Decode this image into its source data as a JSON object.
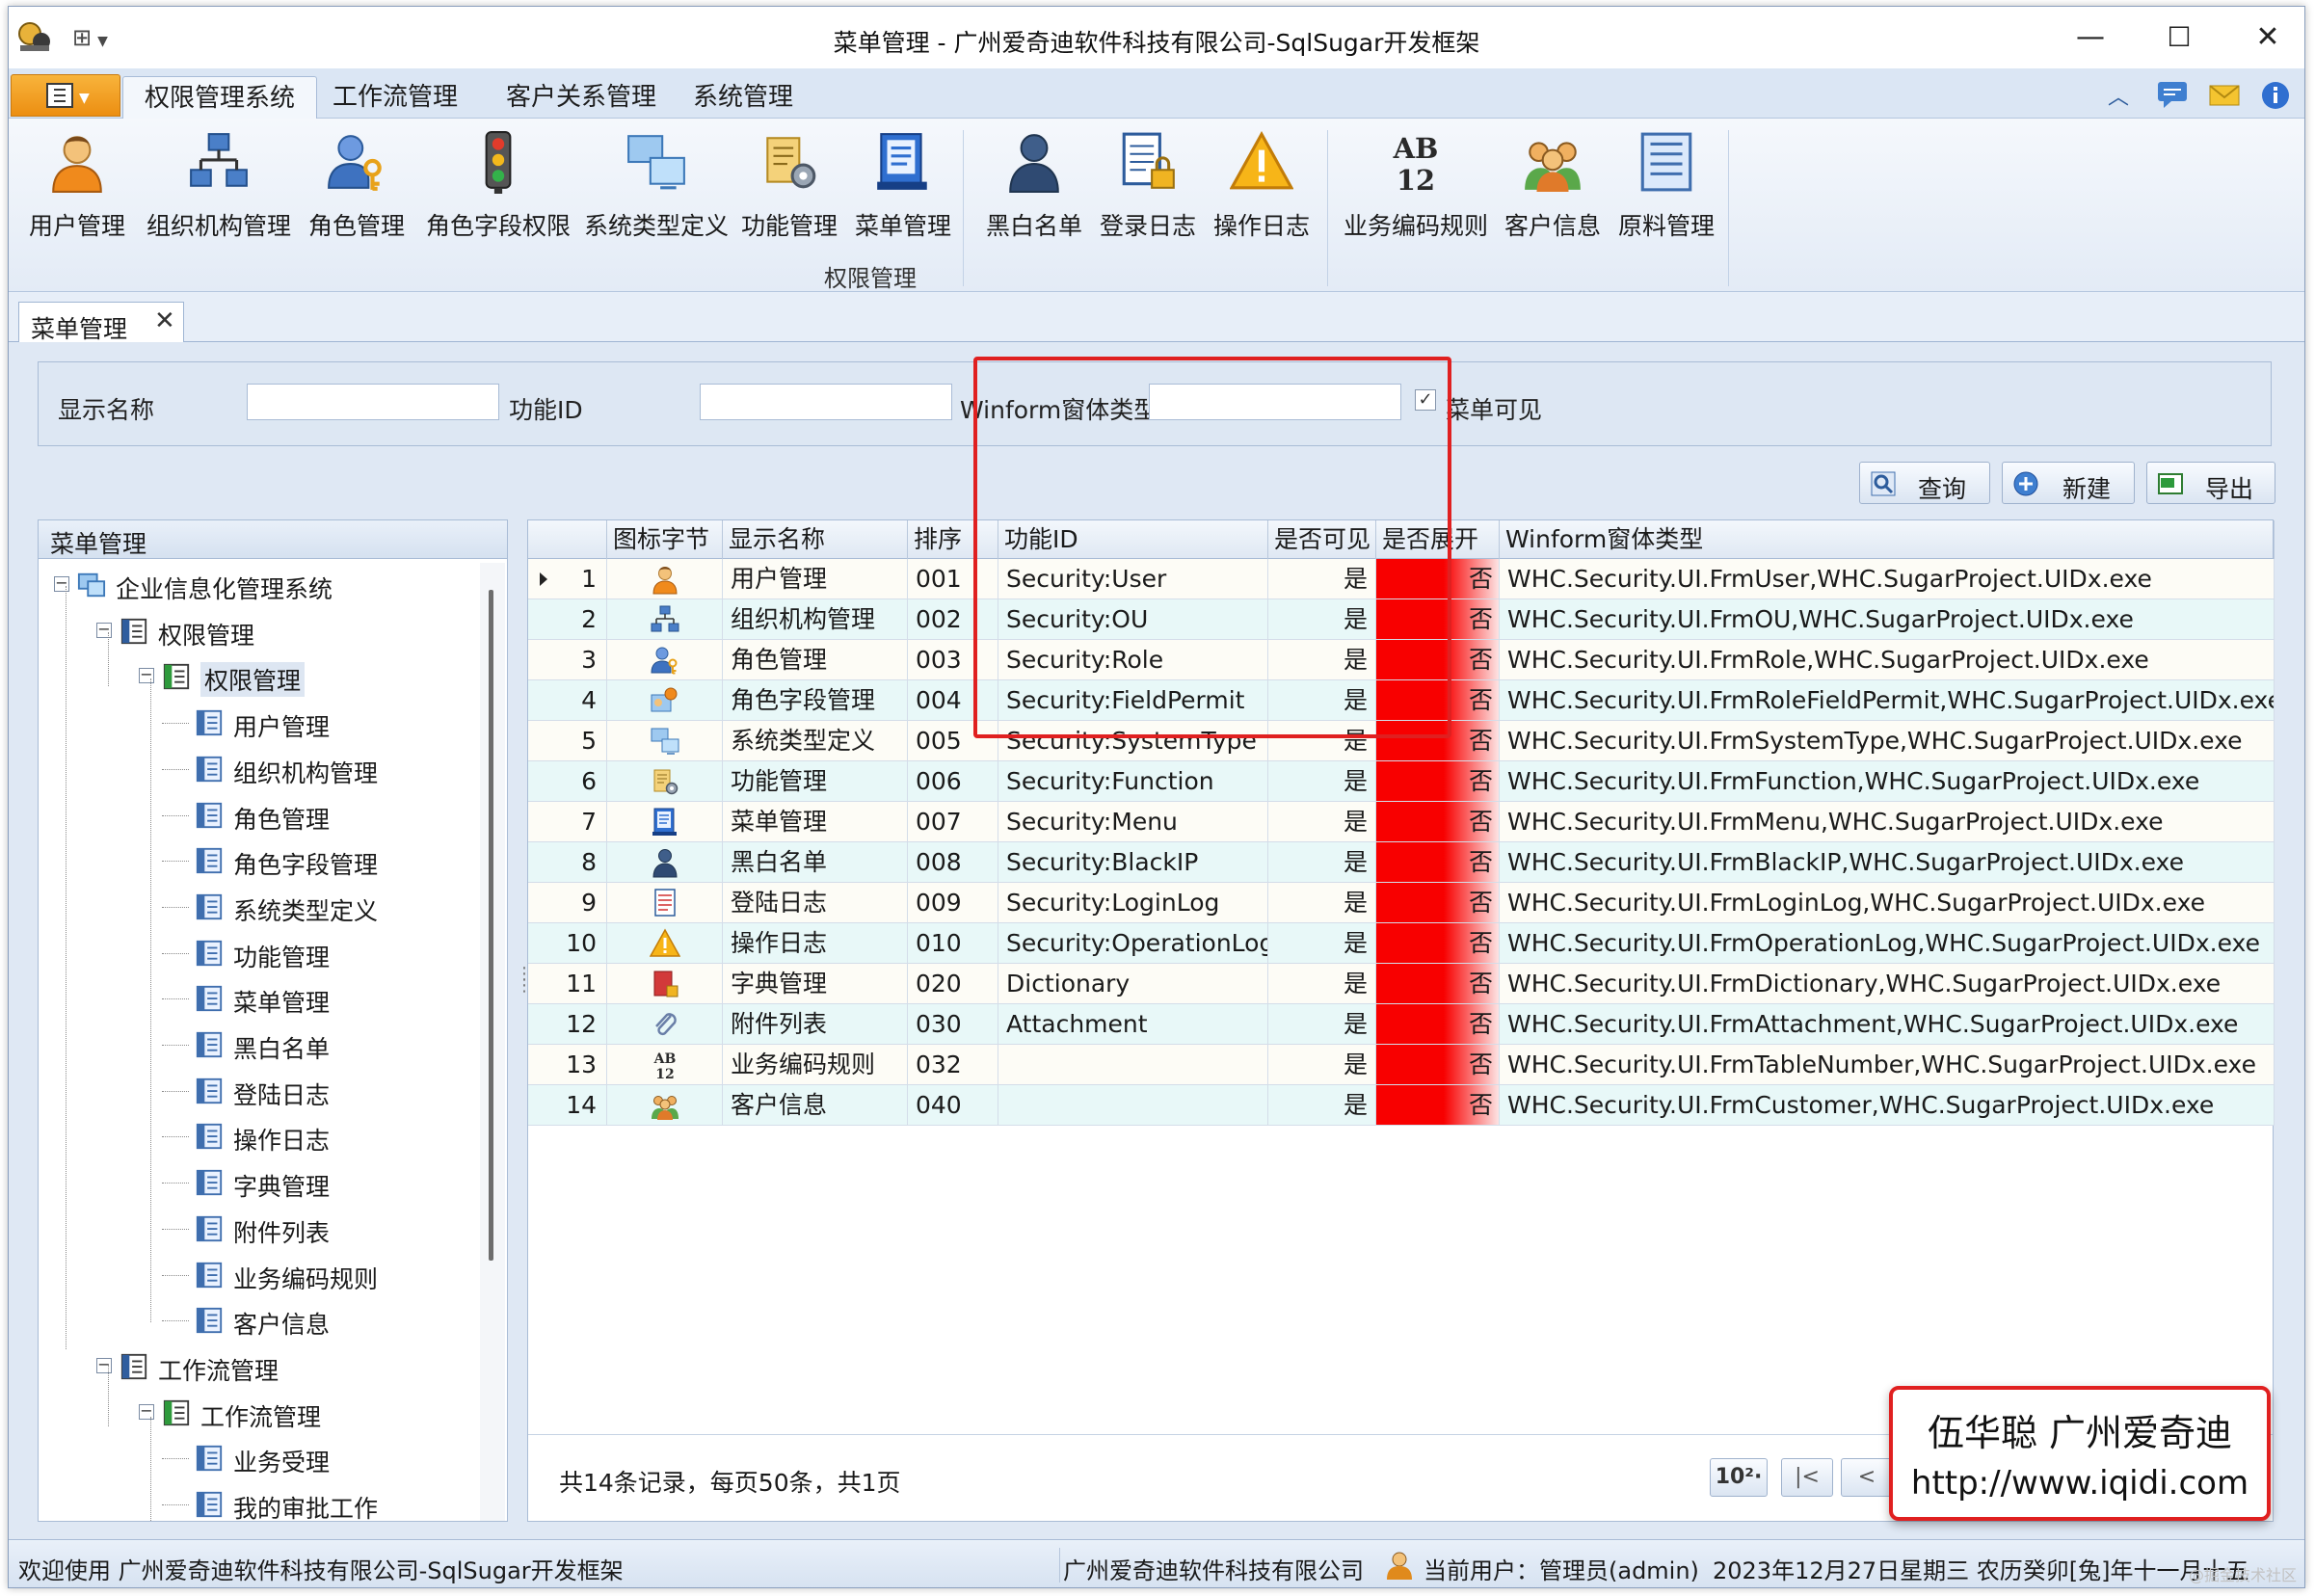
{
  "window": {
    "title": "菜单管理 - 广州爱奇迪软件科技有限公司-SqlSugar开发框架",
    "minimize": "—",
    "maximize": "☐",
    "close": "✕"
  },
  "ribbon": {
    "tabs": [
      "权限管理系统",
      "工作流管理",
      "客户关系管理",
      "系统管理"
    ],
    "buttons": [
      {
        "label": "用户管理",
        "icon": "user-icon"
      },
      {
        "label": "组织机构管理",
        "icon": "org-chart-icon"
      },
      {
        "label": "角色管理",
        "icon": "role-key-icon"
      },
      {
        "label": "角色字段权限",
        "icon": "traffic-light-icon"
      },
      {
        "label": "系统类型定义",
        "icon": "monitors-icon"
      },
      {
        "label": "功能管理",
        "icon": "function-gear-icon"
      },
      {
        "label": "菜单管理",
        "icon": "menu-book-icon"
      },
      {
        "label": "黑白名单",
        "icon": "person-icon"
      },
      {
        "label": "登录日志",
        "icon": "log-lock-icon"
      },
      {
        "label": "操作日志",
        "icon": "warning-icon"
      },
      {
        "label": "业务编码规则",
        "icon": "ab12-icon"
      },
      {
        "label": "客户信息",
        "icon": "customers-icon"
      },
      {
        "label": "原料管理",
        "icon": "material-list-icon"
      }
    ],
    "group_label": "权限管理"
  },
  "doc_tab": {
    "label": "菜单管理",
    "close": "✕"
  },
  "search": {
    "display_name_label": "显示名称",
    "function_id_label": "功能ID",
    "winform_label": "Winform窗体类型",
    "visible_label": "菜单可见",
    "visible_checked": "✓",
    "display_name_value": "",
    "function_id_value": "",
    "winform_value": ""
  },
  "actions": {
    "query": "查询",
    "new": "新建",
    "export": "导出"
  },
  "tree": {
    "header": "菜单管理",
    "nodes": [
      {
        "label": "企业信息化管理系统",
        "level": 0,
        "exp": "−"
      },
      {
        "label": "权限管理",
        "level": 1,
        "exp": "−"
      },
      {
        "label": "权限管理",
        "level": 2,
        "exp": "−"
      },
      {
        "label": "用户管理",
        "level": 3
      },
      {
        "label": "组织机构管理",
        "level": 3
      },
      {
        "label": "角色管理",
        "level": 3
      },
      {
        "label": "角色字段管理",
        "level": 3
      },
      {
        "label": "系统类型定义",
        "level": 3
      },
      {
        "label": "功能管理",
        "level": 3
      },
      {
        "label": "菜单管理",
        "level": 3
      },
      {
        "label": "黑白名单",
        "level": 3
      },
      {
        "label": "登陆日志",
        "level": 3
      },
      {
        "label": "操作日志",
        "level": 3
      },
      {
        "label": "字典管理",
        "level": 3
      },
      {
        "label": "附件列表",
        "level": 3
      },
      {
        "label": "业务编码规则",
        "level": 3
      },
      {
        "label": "客户信息",
        "level": 3
      },
      {
        "label": "工作流管理",
        "level": 1,
        "exp": "−"
      },
      {
        "label": "工作流管理",
        "level": 2,
        "exp": "−"
      },
      {
        "label": "业务受理",
        "level": 3
      },
      {
        "label": "我的审批工作",
        "level": 3
      }
    ]
  },
  "grid": {
    "columns": [
      "图标字节",
      "显示名称",
      "排序",
      "功能ID",
      "是否可见",
      "是否展开",
      "Winform窗体类型"
    ],
    "rows": [
      {
        "no": "1",
        "name": "用户管理",
        "sort": "001",
        "fid": "Security:User",
        "visible": "是",
        "expand": "否",
        "winform": "WHC.Security.UI.FrmUser,WHC.SugarProject.UIDx.exe",
        "icon": "user-icon"
      },
      {
        "no": "2",
        "name": "组织机构管理",
        "sort": "002",
        "fid": "Security:OU",
        "visible": "是",
        "expand": "否",
        "winform": "WHC.Security.UI.FrmOU,WHC.SugarProject.UIDx.exe",
        "icon": "org-chart-icon"
      },
      {
        "no": "3",
        "name": "角色管理",
        "sort": "003",
        "fid": "Security:Role",
        "visible": "是",
        "expand": "否",
        "winform": "WHC.Security.UI.FrmRole,WHC.SugarProject.UIDx.exe",
        "icon": "role-key-icon"
      },
      {
        "no": "4",
        "name": "角色字段管理",
        "sort": "004",
        "fid": "Security:FieldPermit",
        "visible": "是",
        "expand": "否",
        "winform": "WHC.Security.UI.FrmRoleFieldPermit,WHC.SugarProject.UIDx.exe",
        "icon": "field-permit-icon"
      },
      {
        "no": "5",
        "name": "系统类型定义",
        "sort": "005",
        "fid": "Security:SystemType",
        "visible": "是",
        "expand": "否",
        "winform": "WHC.Security.UI.FrmSystemType,WHC.SugarProject.UIDx.exe",
        "icon": "monitors-icon"
      },
      {
        "no": "6",
        "name": "功能管理",
        "sort": "006",
        "fid": "Security:Function",
        "visible": "是",
        "expand": "否",
        "winform": "WHC.Security.UI.FrmFunction,WHC.SugarProject.UIDx.exe",
        "icon": "function-gear-icon"
      },
      {
        "no": "7",
        "name": "菜单管理",
        "sort": "007",
        "fid": "Security:Menu",
        "visible": "是",
        "expand": "否",
        "winform": "WHC.Security.UI.FrmMenu,WHC.SugarProject.UIDx.exe",
        "icon": "menu-book-icon"
      },
      {
        "no": "8",
        "name": "黑白名单",
        "sort": "008",
        "fid": "Security:BlackIP",
        "visible": "是",
        "expand": "否",
        "winform": "WHC.Security.UI.FrmBlackIP,WHC.SugarProject.UIDx.exe",
        "icon": "person-icon"
      },
      {
        "no": "9",
        "name": "登陆日志",
        "sort": "009",
        "fid": "Security:LoginLog",
        "visible": "是",
        "expand": "否",
        "winform": "WHC.Security.UI.FrmLoginLog,WHC.SugarProject.UIDx.exe",
        "icon": "log-icon"
      },
      {
        "no": "10",
        "name": "操作日志",
        "sort": "010",
        "fid": "Security:OperationLog",
        "visible": "是",
        "expand": "否",
        "winform": "WHC.Security.UI.FrmOperationLog,WHC.SugarProject.UIDx.exe",
        "icon": "warning-icon"
      },
      {
        "no": "11",
        "name": "字典管理",
        "sort": "020",
        "fid": "Dictionary",
        "visible": "是",
        "expand": "否",
        "winform": "WHC.Security.UI.FrmDictionary,WHC.SugarProject.UIDx.exe",
        "icon": "dictionary-icon"
      },
      {
        "no": "12",
        "name": "附件列表",
        "sort": "030",
        "fid": "Attachment",
        "visible": "是",
        "expand": "否",
        "winform": "WHC.Security.UI.FrmAttachment,WHC.SugarProject.UIDx.exe",
        "icon": "paperclip-icon"
      },
      {
        "no": "13",
        "name": "业务编码规则",
        "sort": "032",
        "fid": "",
        "visible": "是",
        "expand": "否",
        "winform": "WHC.Security.UI.FrmTableNumber,WHC.SugarProject.UIDx.exe",
        "icon": "ab12-icon"
      },
      {
        "no": "14",
        "name": "客户信息",
        "sort": "040",
        "fid": "",
        "visible": "是",
        "expand": "否",
        "winform": "WHC.Security.UI.FrmCustomer,WHC.SugarProject.UIDx.exe",
        "icon": "customers-icon"
      }
    ]
  },
  "pager": {
    "info": "共14条记录，每页50条，共1页",
    "page_size": "10²·",
    "first": "|<",
    "prev": "<"
  },
  "watermark": {
    "line1": "伍华聪 广州爱奇迪",
    "line2": "http://www.iqidi.com",
    "faint": "@掘金技术社区"
  },
  "status": {
    "welcome": "欢迎使用 广州爱奇迪软件科技有限公司-SqlSugar开发框架",
    "company": "广州爱奇迪软件科技有限公司",
    "user": "当前用户：管理员(admin)",
    "date": "2023年12月27日星期三 农历癸卯[兔]年十一月十五"
  },
  "colors": {
    "accent_red": "#e02020",
    "expand_red": "#f80000",
    "ribbon_bg": "#e3ebf6",
    "row_alt": "#e8f8f8"
  }
}
